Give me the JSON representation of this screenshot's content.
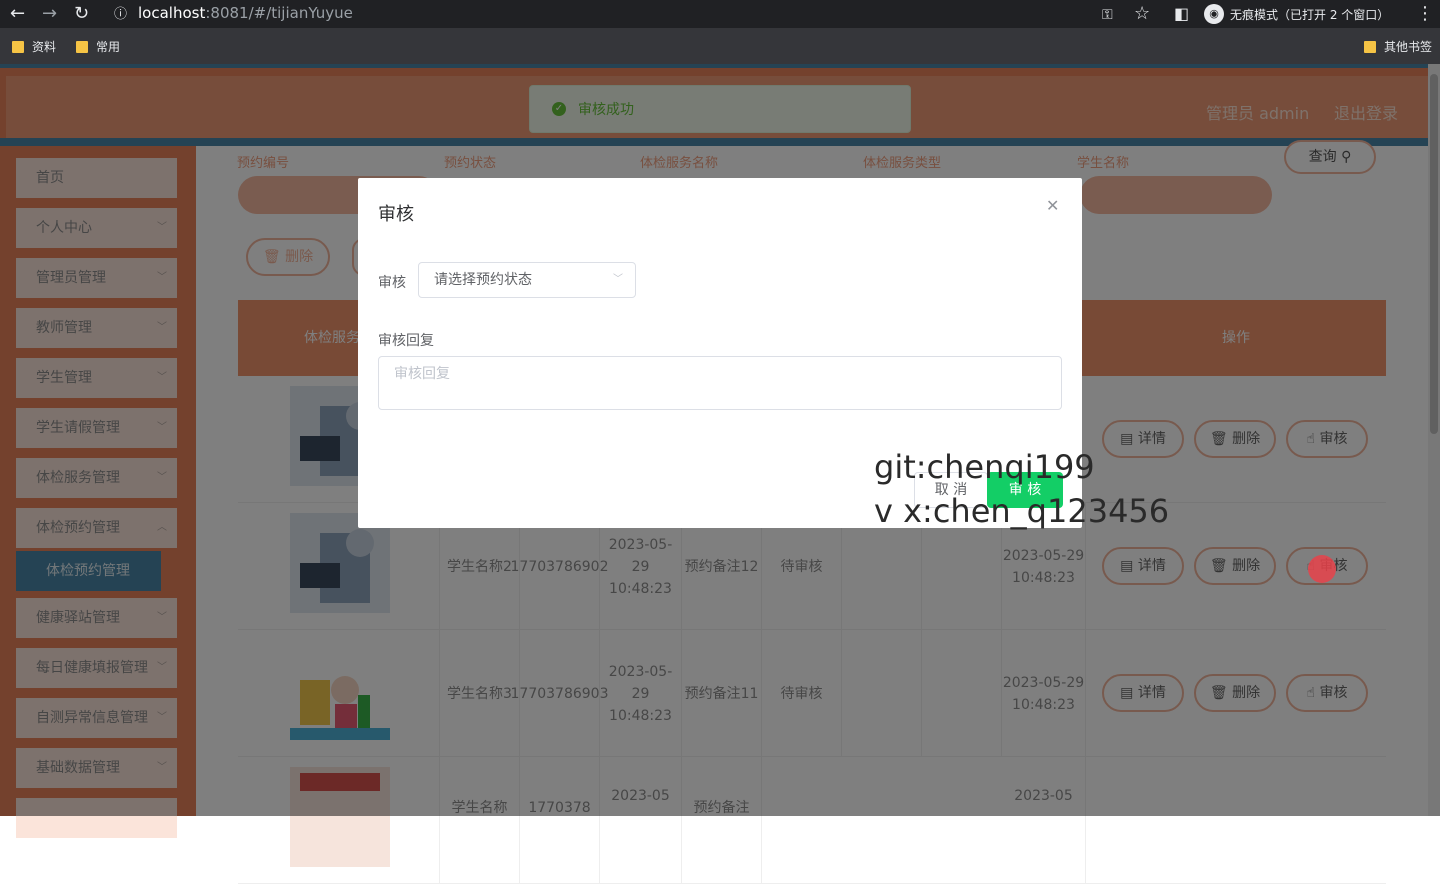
{
  "browser": {
    "url_host": "localhost",
    "url_path": ":8081/#/tijianYuyue",
    "incognito_label": "无痕模式（已打开 2 个窗口）",
    "bookmarks": [
      "资料",
      "常用"
    ],
    "other_bookmarks": "其他书签"
  },
  "header": {
    "admin_label": "管理员 admin",
    "logout_label": "退出登录"
  },
  "toast": {
    "message": "审核成功"
  },
  "sidebar": {
    "items": [
      {
        "label": "首页"
      },
      {
        "label": "个人中心"
      },
      {
        "label": "管理员管理"
      },
      {
        "label": "教师管理"
      },
      {
        "label": "学生管理"
      },
      {
        "label": "学生请假管理"
      },
      {
        "label": "体检服务管理"
      },
      {
        "label": "体检预约管理"
      },
      {
        "label": "健康驿站管理"
      },
      {
        "label": "每日健康填报管理"
      },
      {
        "label": "自测异常信息管理"
      },
      {
        "label": "基础数据管理"
      }
    ],
    "active_sub": "体检预约管理"
  },
  "search": {
    "labels": [
      "预约编号",
      "预约状态",
      "体检服务名称",
      "体检服务类型",
      "学生名称"
    ],
    "query_label": "查询"
  },
  "actions": {
    "delete_label": "删除"
  },
  "table": {
    "headers": {
      "service": "体检服务照",
      "ops": "操作"
    },
    "rows": [
      {
        "student": "",
        "phone": "",
        "time": "",
        "remark": "",
        "status": "",
        "audit_time": ""
      },
      {
        "student": "学生名称2",
        "phone": "17703786902",
        "time": "2023-05-29 10:48:23",
        "remark": "预约备注12",
        "status": "待审核",
        "audit_time": "2023-05-29 10:48:23"
      },
      {
        "student": "学生名称3",
        "phone": "17703786903",
        "time": "2023-05-29 10:48:23",
        "remark": "预约备注11",
        "status": "待审核",
        "audit_time": "2023-05-29 10:48:23"
      },
      {
        "student": "学生名称",
        "phone": "1770378",
        "time": "2023-05",
        "remark": "预约备注",
        "status": "",
        "audit_time": "2023-05"
      }
    ],
    "op_labels": {
      "detail": "详情",
      "delete": "删除",
      "audit": "审核"
    }
  },
  "dialog": {
    "title": "审核",
    "audit_label": "审核",
    "select_placeholder": "请选择预约状态",
    "reply_label": "审核回复",
    "reply_placeholder": "审核回复",
    "cancel_label": "取 消",
    "ok_label": "审 核"
  },
  "watermark": {
    "line1": "git:chenqi199",
    "line2": "v x:chen_q123456"
  }
}
